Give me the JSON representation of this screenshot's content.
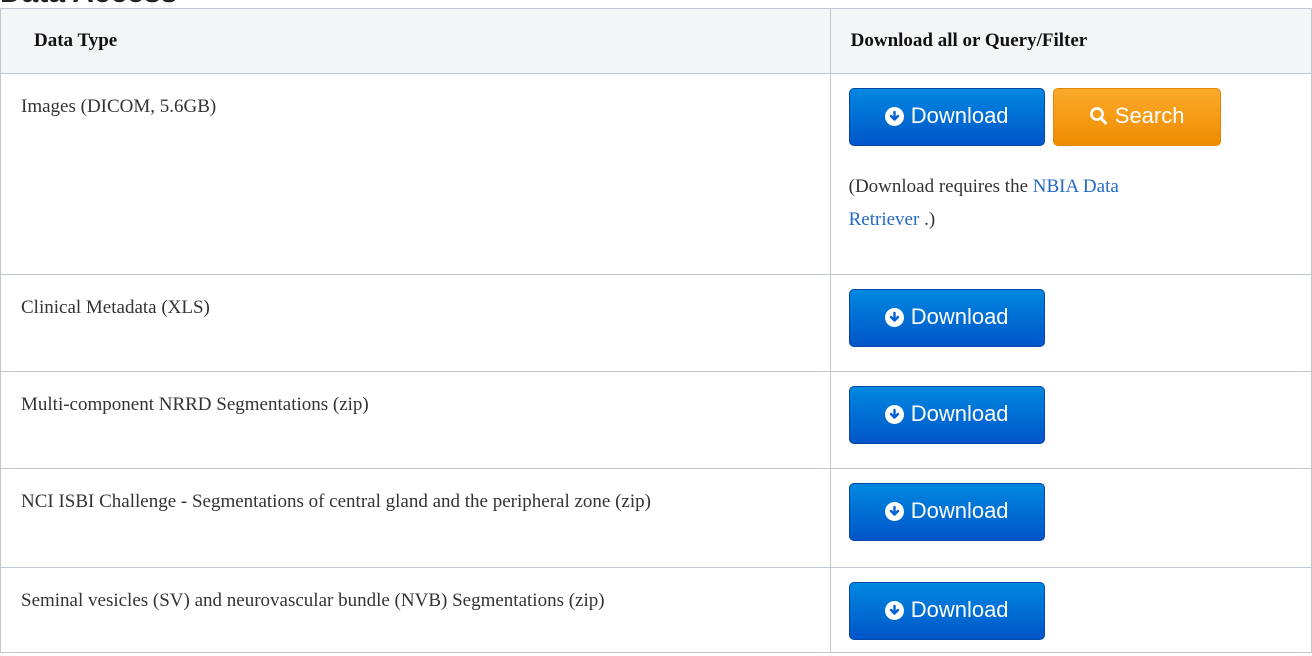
{
  "heading": "Data Access",
  "table": {
    "headers": [
      "Data Type",
      "Download all or Query/Filter"
    ],
    "rows": [
      {
        "type": "Images (DICOM, 5.6GB)",
        "download_label": "Download",
        "search_label": "Search",
        "note_prefix": "(Download requires the ",
        "note_link_line1": "NBIA Data",
        "note_link_line2": "Retriever",
        "note_suffix": " .)"
      },
      {
        "type": "Clinical Metadata (XLS)",
        "download_label": "Download"
      },
      {
        "type": "Multi-component NRRD Segmentations (zip)",
        "download_label": "Download"
      },
      {
        "type": "NCI ISBI Challenge - Segmentations of central gland and the peripheral zone (zip)",
        "download_label": "Download"
      },
      {
        "type": "Seminal vesicles (SV) and neurovascular bundle (NVB) Segmentations (zip)",
        "download_label": "Download"
      }
    ]
  },
  "icons": {
    "download": "circle-down-arrow-icon",
    "search": "magnifier-icon"
  },
  "colors": {
    "download_button": "#0064d6",
    "search_button": "#f59b1a",
    "link": "#2369c6",
    "header_bg": "#f4f5f7",
    "border": "#c1c7d0"
  }
}
